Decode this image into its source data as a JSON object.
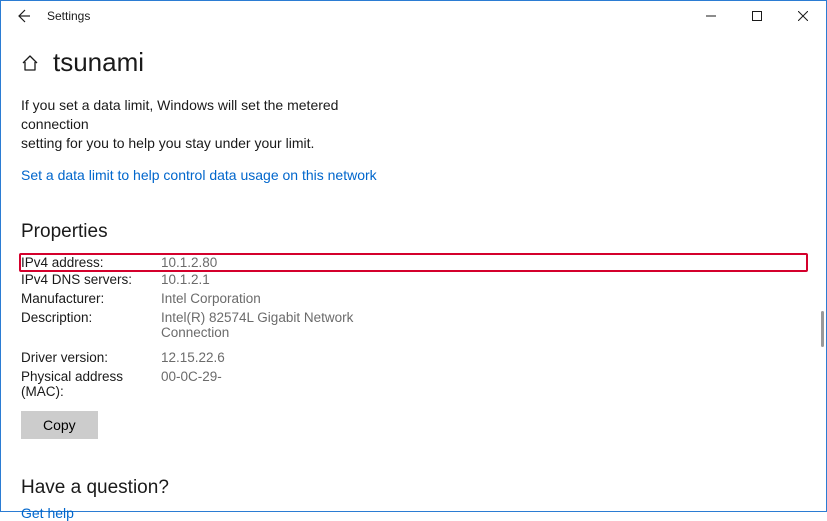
{
  "window": {
    "title": "Settings"
  },
  "page": {
    "title": "tsunami",
    "description_line1": "If you set a data limit, Windows will set the metered connection",
    "description_line2": "setting for you to help you stay under your limit.",
    "data_limit_link": "Set a data limit to help control data usage on this network"
  },
  "properties": {
    "heading": "Properties",
    "rows": [
      {
        "label": "IPv4 address:",
        "value": "10.1.2.80",
        "highlight": true
      },
      {
        "label": "IPv4 DNS servers:",
        "value": "10.1.2.1"
      },
      {
        "label": "Manufacturer:",
        "value": "Intel Corporation"
      },
      {
        "label": "Description:",
        "value": "Intel(R) 82574L Gigabit Network Connection"
      },
      {
        "label": "Driver version:",
        "value": "12.15.22.6"
      },
      {
        "label": "Physical address (MAC):",
        "value": "00-0C-29-"
      }
    ],
    "copy_label": "Copy"
  },
  "help": {
    "heading": "Have a question?",
    "link": "Get help"
  }
}
